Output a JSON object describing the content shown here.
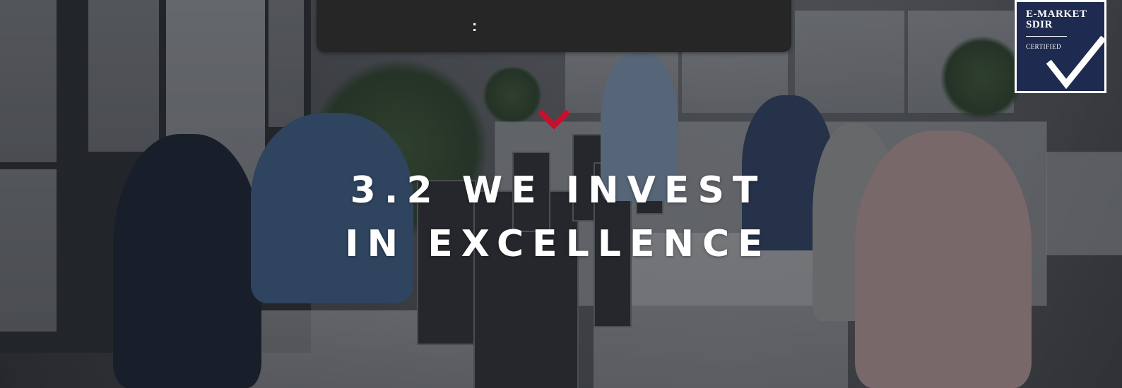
{
  "top_bar": {
    "dots_label": ":"
  },
  "hero": {
    "headline_line1": "3.2 WE INVEST",
    "headline_line2": "IN EXCELLENCE",
    "chevron_icon": "chevron-down-icon",
    "accent_color": "#c8102e"
  },
  "badge": {
    "title": "E-MARKET SDIR",
    "subtitle": "CERTIFIED",
    "check_icon": "checkmark-icon",
    "background_color": "#1e2a4f"
  }
}
